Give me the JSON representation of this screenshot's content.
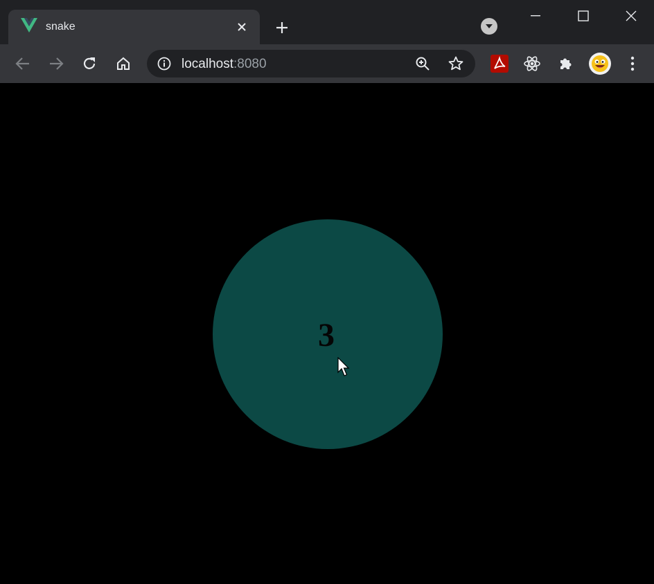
{
  "browser": {
    "tab": {
      "title": "snake",
      "favicon": "vue-logo-icon"
    },
    "address": {
      "host": "localhost",
      "port": ":8080"
    },
    "colors": {
      "vue_green": "#41b883",
      "vue_dark": "#35495e",
      "pdf_red": "#b30b00"
    }
  },
  "page": {
    "countdown": "3",
    "circle_color": "#0c4945",
    "background": "#000000"
  }
}
